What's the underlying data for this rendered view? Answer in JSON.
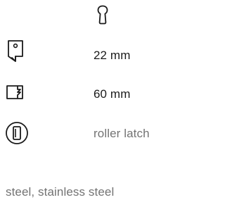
{
  "specs": {
    "cylinder": {
      "icon": "keyhole-cylinder-icon",
      "value": ""
    },
    "backset": {
      "icon": "backset-icon",
      "value": "22 mm"
    },
    "distance": {
      "icon": "distance-icon",
      "value": "60 mm"
    },
    "latch": {
      "icon": "roller-latch-icon",
      "value": "roller latch"
    }
  },
  "material": "steel, stainless steel",
  "colors": {
    "text_primary": "#1a1a1a",
    "text_secondary": "#737373",
    "icon_stroke": "#1a1a1a"
  }
}
